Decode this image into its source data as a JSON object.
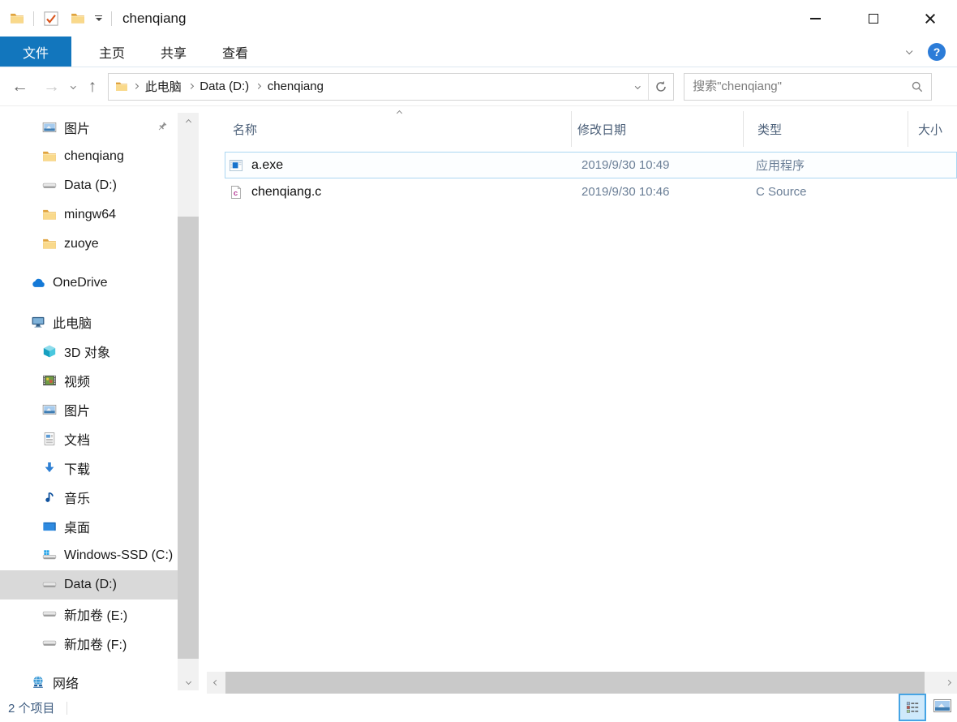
{
  "colors": {
    "accent_blue": "#1276bd",
    "row_selection_border": "#abd7f2",
    "sidebar_selected_bg": "#d9d9d9",
    "help_circle_blue": "#2c7cd8",
    "secondary_text": "#6a7e96"
  },
  "titlebar": {
    "title": "chenqiang"
  },
  "ribbon": {
    "tabs": [
      "文件",
      "主页",
      "共享",
      "查看"
    ],
    "help_label": "?"
  },
  "navbar": {
    "breadcrumb": [
      "此电脑",
      "Data (D:)",
      "chenqiang"
    ],
    "search_placeholder": "搜索\"chenqiang\""
  },
  "sidebar": {
    "items": [
      {
        "label": "图片",
        "icon": "pictures-icon",
        "pinned": true
      },
      {
        "label": "chenqiang",
        "icon": "folder-icon"
      },
      {
        "label": "Data (D:)",
        "icon": "drive-icon"
      },
      {
        "label": "mingw64",
        "icon": "folder-icon"
      },
      {
        "label": "zuoye",
        "icon": "folder-icon"
      },
      {
        "label": "OneDrive",
        "icon": "onedrive-icon"
      },
      {
        "label": "此电脑",
        "icon": "this-pc-icon"
      },
      {
        "label": "3D 对象",
        "icon": "3d-objects-icon"
      },
      {
        "label": "视频",
        "icon": "videos-icon"
      },
      {
        "label": "图片",
        "icon": "pictures-icon"
      },
      {
        "label": "文档",
        "icon": "documents-icon"
      },
      {
        "label": "下载",
        "icon": "downloads-icon"
      },
      {
        "label": "音乐",
        "icon": "music-icon"
      },
      {
        "label": "桌面",
        "icon": "desktop-icon"
      },
      {
        "label": "Windows-SSD (C:)",
        "icon": "windows-drive-icon"
      },
      {
        "label": "Data (D:)",
        "icon": "drive-icon",
        "selected": true
      },
      {
        "label": "新加卷 (E:)",
        "icon": "drive-icon"
      },
      {
        "label": "新加卷 (F:)",
        "icon": "drive-icon"
      },
      {
        "label": "网络",
        "icon": "network-icon"
      }
    ]
  },
  "filelist": {
    "columns": [
      "名称",
      "修改日期",
      "类型",
      "大小"
    ],
    "rows": [
      {
        "name": "a.exe",
        "date": "2019/9/30 10:49",
        "type": "应用程序",
        "size": "",
        "icon": "exe-file-icon",
        "selected": true
      },
      {
        "name": "chenqiang.c",
        "date": "2019/9/30 10:46",
        "type": "C Source",
        "size": "",
        "icon": "c-file-icon"
      }
    ]
  },
  "statusbar": {
    "item_count": "2 个项目"
  }
}
